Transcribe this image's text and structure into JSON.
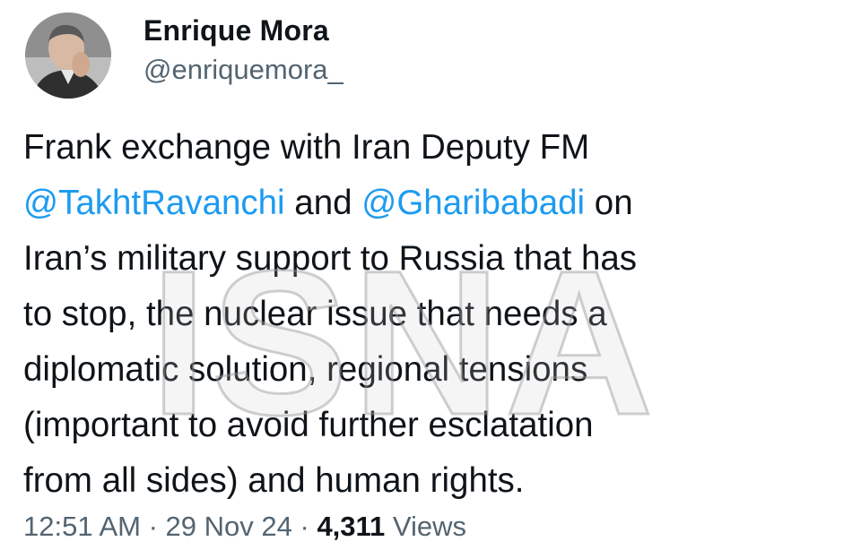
{
  "author": {
    "display_name": "Enrique Mora",
    "handle": "@enriquemora_"
  },
  "tweet": {
    "lines": [
      [
        {
          "text": "Frank exchange with Iran Deputy FM",
          "type": "text"
        }
      ],
      [
        {
          "text": "@TakhtRavanchi",
          "type": "mention"
        },
        {
          "text": " and ",
          "type": "text"
        },
        {
          "text": "@Gharibabadi",
          "type": "mention"
        },
        {
          "text": " on",
          "type": "text"
        }
      ],
      [
        {
          "text": "Iran’s military support to Russia that has",
          "type": "text"
        }
      ],
      [
        {
          "text": "to stop, the nuclear issue that needs a",
          "type": "text"
        }
      ],
      [
        {
          "text": "diplomatic solution, regional tensions",
          "type": "text"
        }
      ],
      [
        {
          "text": "(important to avoid further esclatation",
          "type": "text"
        }
      ],
      [
        {
          "text": "from all sides) and human rights.",
          "type": "text"
        }
      ]
    ]
  },
  "meta": {
    "time": "12:51 AM",
    "separator": " · ",
    "date": "29 Nov 24",
    "views_count": "4,311",
    "views_label": " Views"
  },
  "watermark": {
    "text": "ISNA"
  },
  "colors": {
    "mention": "#1d9bf0",
    "secondary_text": "#536471",
    "primary_text": "#0f1419"
  }
}
